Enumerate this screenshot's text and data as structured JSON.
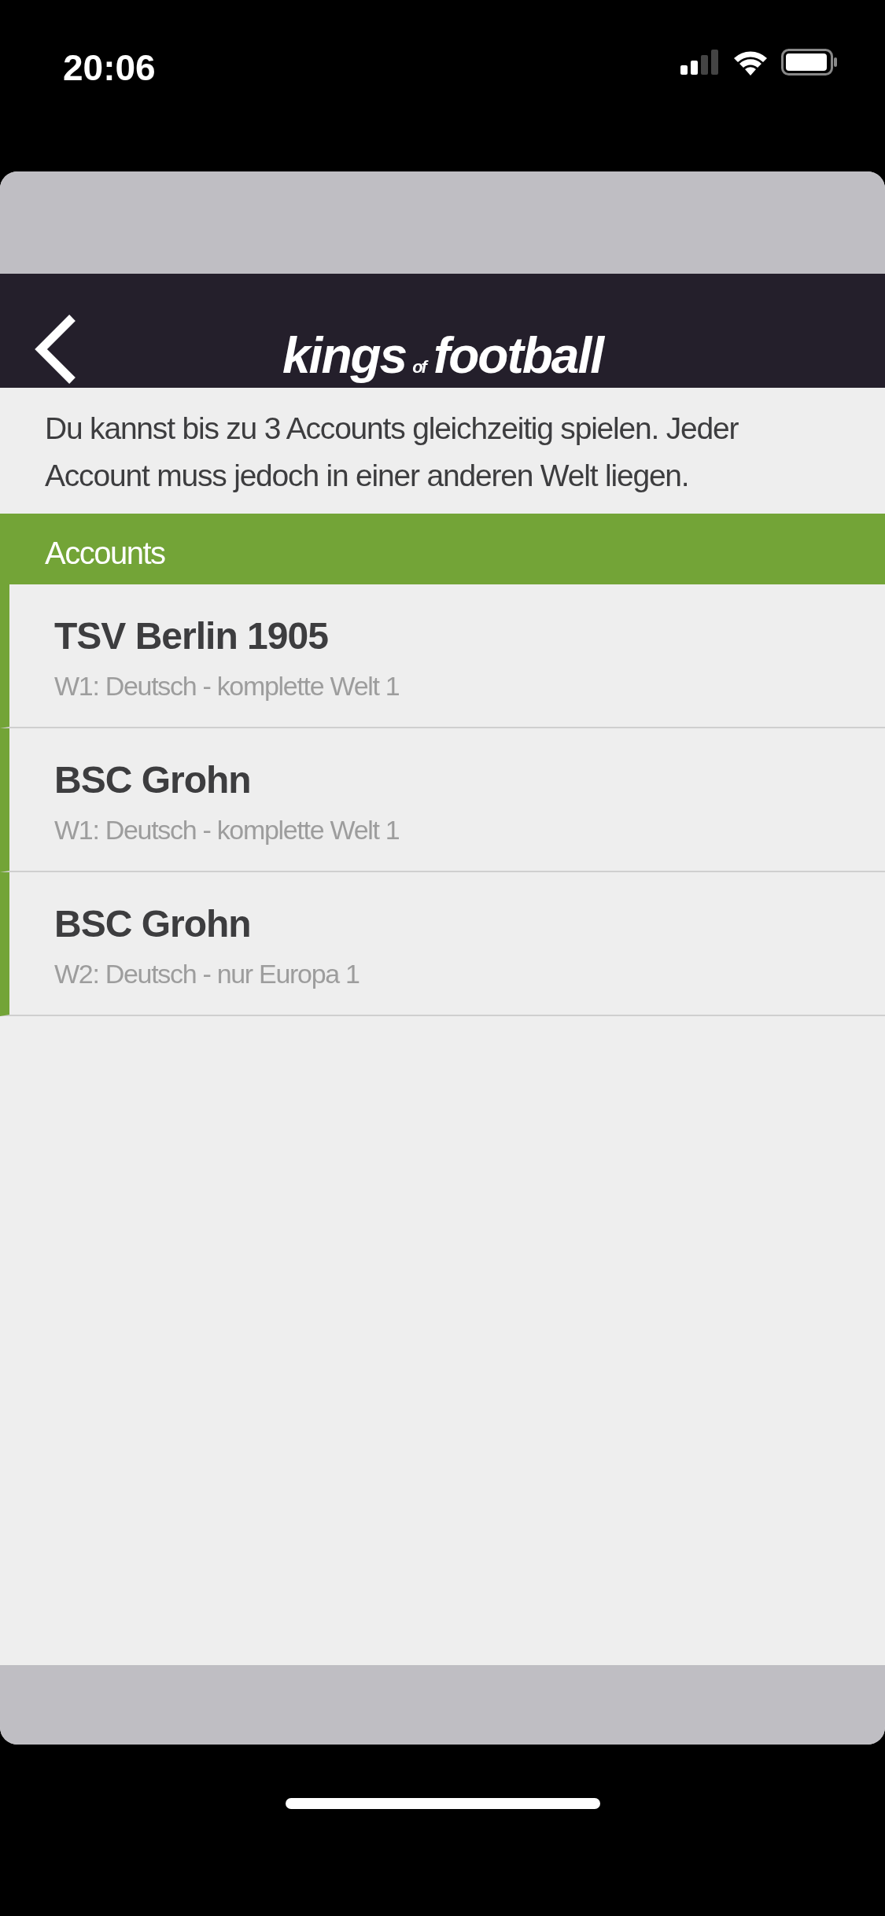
{
  "status_bar": {
    "time": "20:06"
  },
  "header": {
    "logo": {
      "first": "kings",
      "middle": "of",
      "last": "football"
    }
  },
  "intro": "Du kannst bis zu 3 Accounts gleichzeitig spielen. Jeder Account muss jedoch in einer anderen Welt liegen.",
  "section": {
    "title": "Accounts"
  },
  "accounts": [
    {
      "name": "TSV Berlin 1905",
      "world": "W1: Deutsch - komplette Welt 1"
    },
    {
      "name": "BSC Grohn",
      "world": "W1: Deutsch - komplette Welt 1"
    },
    {
      "name": "BSC Grohn",
      "world": "W2: Deutsch - nur Europa 1"
    }
  ]
}
